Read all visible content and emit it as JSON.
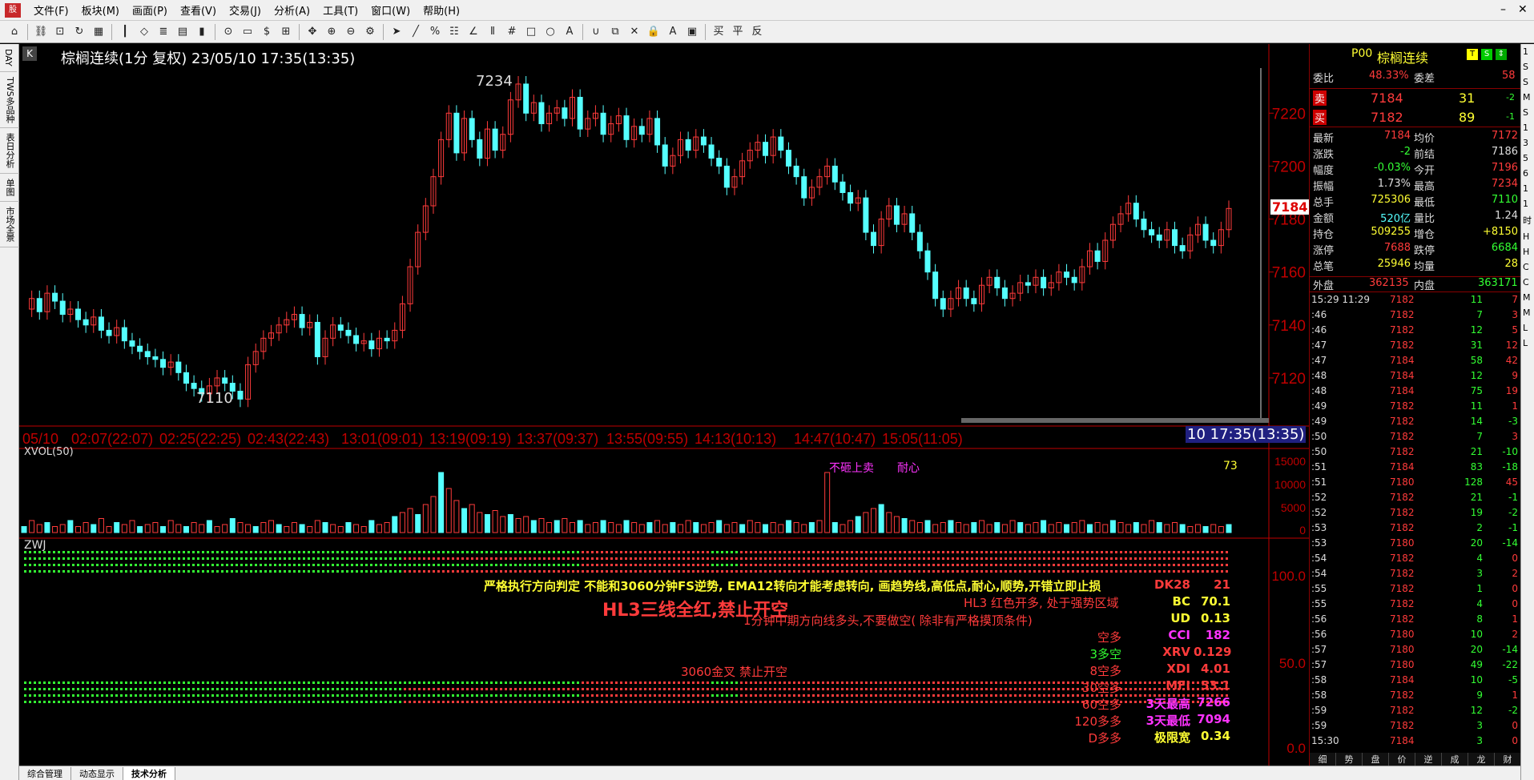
{
  "menubar": {
    "app_icon": "股",
    "items": [
      "文件(F)",
      "板块(M)",
      "画面(P)",
      "查看(V)",
      "交易(J)",
      "分析(A)",
      "工具(T)",
      "窗口(W)",
      "帮助(H)"
    ],
    "minimize": "–",
    "close": "✕"
  },
  "left_tabs": [
    "DAY",
    "TWS多品种",
    "表日分析",
    "单图",
    "市场全景"
  ],
  "right_edge": [
    "1",
    "S",
    "S",
    "M",
    "S",
    "1",
    "3",
    "5",
    "6",
    "1",
    "1",
    "时",
    "H",
    "H",
    "C",
    "C",
    "M",
    "M",
    "L",
    "L"
  ],
  "bottom_tabs": [
    "综合管理",
    "动态显示",
    "技术分析"
  ],
  "chart": {
    "badge": "K",
    "title": "棕榈连续(1分 复权) 23/05/10 17:35(13:35)",
    "high_label": "7234",
    "low_label": "7110",
    "last_price_tag": "7184",
    "price_ticks": [
      "7220",
      "7200",
      "7180",
      "7160",
      "7140",
      "7120"
    ],
    "time_axis": [
      "05/10",
      "02:07(22:07)",
      "02:25(22:25)",
      "02:43(22:43)",
      "13:01(09:01)",
      "13:19(09:19)",
      "13:37(09:37)",
      "13:55(09:55)",
      "14:13(10:13)",
      "14:47(10:47)",
      "15:05(11:05)"
    ],
    "time_cursor": "10 17:35(13:35)",
    "candles": [
      7146,
      7150,
      7145,
      7152,
      7149,
      7144,
      7146,
      7142,
      7140,
      7143,
      7138,
      7136,
      7139,
      7134,
      7132,
      7130,
      7128,
      7127,
      7124,
      7126,
      7122,
      7118,
      7116,
      7114,
      7117,
      7120,
      7118,
      7115,
      7112,
      7125,
      7130,
      7135,
      7137,
      7140,
      7142,
      7144,
      7139,
      7141,
      7128,
      7135,
      7140,
      7138,
      7136,
      7133,
      7134,
      7131,
      7135,
      7134,
      7138,
      7148,
      7162,
      7175,
      7185,
      7196,
      7210,
      7220,
      7205,
      7218,
      7210,
      7203,
      7214,
      7206,
      7212,
      7225,
      7231,
      7220,
      7224,
      7216,
      7220,
      7222,
      7218,
      7226,
      7214,
      7218,
      7220,
      7212,
      7216,
      7219,
      7210,
      7215,
      7212,
      7218,
      7208,
      7200,
      7204,
      7210,
      7206,
      7211,
      7208,
      7203,
      7200,
      7192,
      7196,
      7202,
      7206,
      7209,
      7204,
      7211,
      7206,
      7200,
      7196,
      7188,
      7192,
      7196,
      7200,
      7194,
      7190,
      7186,
      7188,
      7175,
      7170,
      7180,
      7185,
      7178,
      7182,
      7175,
      7168,
      7160,
      7150,
      7146,
      7150,
      7154,
      7150,
      7148,
      7155,
      7158,
      7154,
      7150,
      7152,
      7156,
      7155,
      7158,
      7154,
      7156,
      7160,
      7158,
      7156,
      7162,
      7168,
      7164,
      7172,
      7178,
      7182,
      7186,
      7180,
      7176,
      7174,
      7172,
      7176,
      7170,
      7168,
      7174,
      7178,
      7172,
      7170,
      7176,
      7184
    ],
    "xvol": {
      "label": "XVOL(50)",
      "value": "73",
      "ticks": [
        "15000",
        "10000",
        "5000",
        "0"
      ],
      "bars": [
        3,
        6,
        4,
        5,
        3,
        4,
        6,
        3,
        5,
        4,
        7,
        3,
        5,
        4,
        6,
        3,
        4,
        5,
        3,
        6,
        4,
        3,
        5,
        4,
        6,
        3,
        4,
        7,
        5,
        4,
        3,
        5,
        6,
        4,
        3,
        5,
        4,
        3,
        6,
        5,
        4,
        3,
        5,
        4,
        3,
        6,
        4,
        5,
        8,
        10,
        12,
        9,
        14,
        18,
        30,
        22,
        16,
        12,
        14,
        10,
        9,
        11,
        8,
        9,
        7,
        8,
        6,
        7,
        5,
        6,
        7,
        5,
        6,
        4,
        5,
        6,
        5,
        4,
        6,
        5,
        4,
        5,
        6,
        4,
        5,
        4,
        6,
        5,
        4,
        5,
        6,
        4,
        5,
        4,
        6,
        5,
        4,
        5,
        4,
        6,
        5,
        4,
        5,
        6,
        30,
        5,
        4,
        6,
        8,
        10,
        12,
        14,
        10,
        8,
        7,
        6,
        5,
        6,
        4,
        5,
        6,
        5,
        4,
        5,
        6,
        4,
        5,
        4,
        6,
        5,
        4,
        5,
        6,
        4,
        5,
        4,
        5,
        6,
        4,
        5,
        4,
        6,
        5,
        4,
        5,
        4,
        6,
        5,
        4,
        5,
        4,
        3,
        4,
        3,
        4,
        3,
        4
      ],
      "markers": [
        {
          "text": "不砸上卖",
          "color": "#ff33ff"
        },
        {
          "text": "耐心",
          "color": "#ff33ff"
        }
      ]
    },
    "zwj": {
      "label": "ZWJ",
      "ticks": [
        "100.0",
        "50.0",
        "0.0"
      ],
      "line1": "严格执行方向判定 不能和3060分钟FS逆势, EMA12转向才能考虑转向, 画趋势线,高低点,耐心,顺势,开错立即止损",
      "line2": "HL3 红色开多, 处于强势区域",
      "headline": "HL3三线全红,禁止开空",
      "line3": "1分钟中期方向线多头,不要做空( 除非有严格摸顶条件)",
      "line4": "3060金叉 禁止开空",
      "left_stack": [
        {
          "text": "空多",
          "color": "#ff3b3b"
        },
        {
          "text": "3多空",
          "color": "#33ff33"
        },
        {
          "text": "8空多",
          "color": "#ff3b3b"
        },
        {
          "text": "30空多",
          "color": "#ff3b3b"
        },
        {
          "text": "60空多",
          "color": "#ff3b3b"
        },
        {
          "text": "120多多",
          "color": "#ff3b3b"
        },
        {
          "text": "D多多",
          "color": "#ff3b3b"
        }
      ],
      "stats": [
        {
          "label": "DK28",
          "value": "21",
          "lc": "#ff3b3b",
          "vc": "#ff3b3b"
        },
        {
          "label": "BC",
          "value": "70.1",
          "lc": "#ffff33",
          "vc": "#ffff33"
        },
        {
          "label": "UD",
          "value": "0.13",
          "lc": "#ffff33",
          "vc": "#ffff33"
        },
        {
          "label": "CCI",
          "value": "182",
          "lc": "#ff33ff",
          "vc": "#ff33ff"
        },
        {
          "label": "XRV",
          "value": "0.129",
          "lc": "#ff3b3b",
          "vc": "#ff3b3b"
        },
        {
          "label": "XDI",
          "value": "4.01",
          "lc": "#ff3b3b",
          "vc": "#ff3b3b"
        },
        {
          "label": "MFI",
          "value": "53.1",
          "lc": "#ff3b3b",
          "vc": "#ff3b3b"
        },
        {
          "label": "3天最高",
          "value": "7266",
          "lc": "#ff33ff",
          "vc": "#ff33ff"
        },
        {
          "label": "3天最低",
          "value": "7094",
          "lc": "#ff33ff",
          "vc": "#ff33ff"
        },
        {
          "label": "极限宽",
          "value": "0.34",
          "lc": "#ffff33",
          "vc": "#ffff33"
        }
      ]
    }
  },
  "quote": {
    "code": "P00",
    "name": "棕榈连续",
    "ratio_label": "委比",
    "ratio": "48.33%",
    "diff_label": "委差",
    "diff": "58",
    "sell_label": "卖",
    "sell_price": "7184",
    "sell_qty": "31",
    "sell_chg": "-2",
    "buy_label": "买",
    "buy_price": "7182",
    "buy_qty": "89",
    "buy_chg": "-1",
    "stats": [
      {
        "l1": "最新",
        "v1": "7184",
        "c1": "#ff3b3b",
        "l2": "均价",
        "v2": "7172",
        "c2": "#ff3b3b"
      },
      {
        "l1": "涨跌",
        "v1": "-2",
        "c1": "#33ff33",
        "l2": "前结",
        "v2": "7186",
        "c2": "#ddd"
      },
      {
        "l1": "幅度",
        "v1": "-0.03%",
        "c1": "#33ff33",
        "l2": "今开",
        "v2": "7196",
        "c2": "#ff3b3b"
      },
      {
        "l1": "振幅",
        "v1": "1.73%",
        "c1": "#ddd",
        "l2": "最高",
        "v2": "7234",
        "c2": "#ff3b3b"
      },
      {
        "l1": "总手",
        "v1": "725306",
        "c1": "#ffff33",
        "l2": "最低",
        "v2": "7110",
        "c2": "#33ff33"
      },
      {
        "l1": "金额",
        "v1": "520亿",
        "c1": "#55ffff",
        "l2": "量比",
        "v2": "1.24",
        "c2": "#ddd"
      },
      {
        "l1": "持仓",
        "v1": "509255",
        "c1": "#ffff33",
        "l2": "增仓",
        "v2": "+8150",
        "c2": "#ffff33"
      },
      {
        "l1": "涨停",
        "v1": "7688",
        "c1": "#ff3b3b",
        "l2": "跌停",
        "v2": "6684",
        "c2": "#33ff33"
      },
      {
        "l1": "总笔",
        "v1": "25946",
        "c1": "#ffff33",
        "l2": "均量",
        "v2": "28",
        "c2": "#ffff33"
      }
    ],
    "outer_label": "外盘",
    "outer": "362135",
    "inner_label": "内盘",
    "inner": "363171",
    "ticks": [
      {
        "t": "15:29 11:29",
        "p": "7182",
        "q": "11",
        "c": "7"
      },
      {
        "t": ":46",
        "p": "7182",
        "q": "7",
        "c": "3"
      },
      {
        "t": ":46",
        "p": "7182",
        "q": "12",
        "c": "5"
      },
      {
        "t": ":47",
        "p": "7182",
        "q": "31",
        "c": "12"
      },
      {
        "t": ":47",
        "p": "7184",
        "q": "58",
        "c": "42"
      },
      {
        "t": ":48",
        "p": "7184",
        "q": "12",
        "c": "9"
      },
      {
        "t": ":48",
        "p": "7184",
        "q": "75",
        "c": "19"
      },
      {
        "t": ":49",
        "p": "7182",
        "q": "11",
        "c": "1"
      },
      {
        "t": ":49",
        "p": "7182",
        "q": "14",
        "c": "-3"
      },
      {
        "t": ":50",
        "p": "7182",
        "q": "7",
        "c": "3"
      },
      {
        "t": ":50",
        "p": "7182",
        "q": "21",
        "c": "-10"
      },
      {
        "t": ":51",
        "p": "7184",
        "q": "83",
        "c": "-18"
      },
      {
        "t": ":51",
        "p": "7180",
        "q": "128",
        "c": "45"
      },
      {
        "t": ":52",
        "p": "7182",
        "q": "21",
        "c": "-1"
      },
      {
        "t": ":52",
        "p": "7182",
        "q": "19",
        "c": "-2"
      },
      {
        "t": ":53",
        "p": "7182",
        "q": "2",
        "c": "-1"
      },
      {
        "t": ":53",
        "p": "7180",
        "q": "20",
        "c": "-14"
      },
      {
        "t": ":54",
        "p": "7182",
        "q": "4",
        "c": "0"
      },
      {
        "t": ":54",
        "p": "7182",
        "q": "3",
        "c": "2"
      },
      {
        "t": ":55",
        "p": "7182",
        "q": "1",
        "c": "0"
      },
      {
        "t": ":55",
        "p": "7182",
        "q": "4",
        "c": "0"
      },
      {
        "t": ":56",
        "p": "7182",
        "q": "8",
        "c": "1"
      },
      {
        "t": ":56",
        "p": "7180",
        "q": "10",
        "c": "2"
      },
      {
        "t": ":57",
        "p": "7180",
        "q": "20",
        "c": "-14"
      },
      {
        "t": ":57",
        "p": "7180",
        "q": "49",
        "c": "-22"
      },
      {
        "t": ":58",
        "p": "7184",
        "q": "10",
        "c": "-5"
      },
      {
        "t": ":58",
        "p": "7182",
        "q": "9",
        "c": "1"
      },
      {
        "t": ":59",
        "p": "7182",
        "q": "12",
        "c": "-2"
      },
      {
        "t": ":59",
        "p": "7182",
        "q": "3",
        "c": "0"
      },
      {
        "t": "15:30",
        "p": "7184",
        "q": "3",
        "c": "0"
      }
    ],
    "tabs": [
      "细",
      "势",
      "盘",
      "价",
      "逆",
      "成",
      "龙",
      "财"
    ]
  },
  "colors": {
    "up": "#ff3b3b",
    "down": "#55ffff",
    "axis": "#c00000"
  }
}
